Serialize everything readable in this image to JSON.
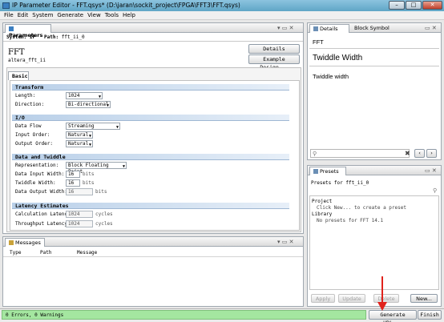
{
  "window": {
    "title": "IP Parameter Editor - FFT.qsys* (D:\\jaran\\sockit_project\\FPGA\\FFT3\\FFT.qsys)",
    "minimize": "–",
    "maximize": "□",
    "close": "✕"
  },
  "menu": [
    "File",
    "Edit",
    "System",
    "Generate",
    "View",
    "Tools",
    "Help"
  ],
  "parameters_panel": {
    "tab": "Parameters",
    "system_label": "System:",
    "system_value": "IP",
    "path_label": "Path:",
    "path_value": "fft_ii_0",
    "component_title": "FFT",
    "component_subtitle": "altera_fft_ii",
    "details_button": "Details",
    "example_button": "Example Design...",
    "inner_tab": "Basic",
    "sections": {
      "transform": "Transform",
      "io": "I/O",
      "data_twiddle": "Data and Twiddle",
      "latency": "Latency Estimates"
    },
    "fields": {
      "length_label": "Length:",
      "length_value": "1024",
      "direction_label": "Direction:",
      "direction_value": "Bi-directional",
      "dataflow_label": "Data Flow",
      "dataflow_value": "Streaming",
      "input_order_label": "Input Order:",
      "input_order_value": "Natural",
      "output_order_label": "Output Order:",
      "output_order_value": "Natural",
      "representation_label": "Representation:",
      "representation_value": "Block Floating Point",
      "data_input_width_label": "Data Input Width:",
      "data_input_width_value": "16",
      "data_input_width_unit": "bits",
      "twiddle_width_label": "Twiddle Width:",
      "twiddle_width_value": "16",
      "twiddle_width_unit": "bits",
      "data_output_width_label": "Data Output Width:",
      "data_output_width_value": "16",
      "data_output_width_unit": "bits",
      "calc_latency_label": "Calculation Latency:",
      "calc_latency_value": "1024",
      "calc_latency_unit": "cycles",
      "throughput_latency_label": "Throughput Latency:",
      "throughput_latency_value": "1024",
      "throughput_latency_unit": "cycles"
    }
  },
  "messages_panel": {
    "tab": "Messages",
    "columns": [
      "Type",
      "Path",
      "Message"
    ]
  },
  "details_panel": {
    "tab_details": "Details",
    "tab_block": "Block Symbol",
    "name": "FFT",
    "heading": "Twiddle Width",
    "description": "Twiddle width"
  },
  "presets_panel": {
    "tab": "Presets",
    "presets_for": "Presets for fft_ii_0",
    "project_label": "Project",
    "project_hint": "Click New... to create a preset",
    "library_label": "Library",
    "library_hint": "No presets for FFT 14.1",
    "buttons": [
      "Apply",
      "Update",
      "Delete",
      "New..."
    ]
  },
  "status": {
    "text": "0 Errors, 0 Warnings",
    "generate": "Generate HDL...",
    "finish": "Finish"
  },
  "colors": {
    "accent": "#3c7fc1",
    "section": "#b8cfe8",
    "status_green": "#a4e6a0",
    "arrow": "#e0231c"
  }
}
